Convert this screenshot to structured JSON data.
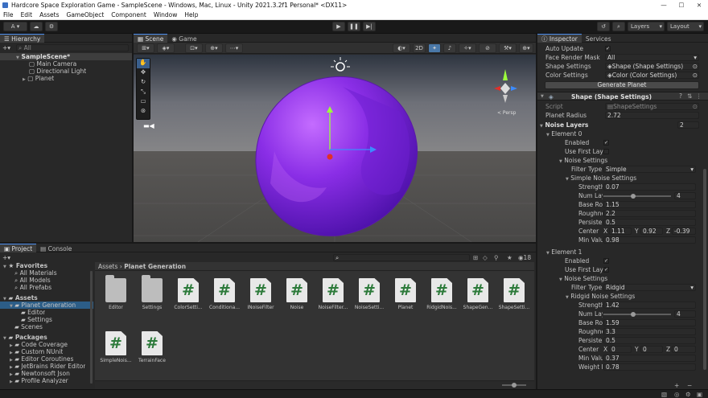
{
  "window": {
    "title": "Hardcore Space Exploration Game - SampleScene - Windows, Mac, Linux - Unity 2021.3.2f1 Personal* <DX11>",
    "minimize": "—",
    "maximize": "☐",
    "close": "✕"
  },
  "menu": [
    "File",
    "Edit",
    "Assets",
    "GameObject",
    "Component",
    "Window",
    "Help"
  ],
  "toolbar": {
    "account": "A",
    "layers": "Layers",
    "layout": "Layout"
  },
  "hierarchy": {
    "tab": "Hierarchy",
    "search_placeholder": "All",
    "scene": "SampleScene*",
    "items": [
      "Main Camera",
      "Directional Light",
      "Planet"
    ]
  },
  "scene": {
    "tabs": [
      "Scene",
      "Game"
    ],
    "mode2d": "2D",
    "persp": "< Persp"
  },
  "project": {
    "tabs": [
      "Project",
      "Console"
    ],
    "breadcrumb": [
      "Assets",
      "Planet Generation"
    ],
    "count": "18",
    "favorites": {
      "label": "Favorites",
      "items": [
        "All Materials",
        "All Models",
        "All Prefabs"
      ]
    },
    "assets_tree": {
      "label": "Assets",
      "items": [
        {
          "label": "Planet Generation",
          "children": [
            "Editor",
            "Settings"
          ]
        },
        {
          "label": "Scenes"
        }
      ]
    },
    "packages": {
      "label": "Packages",
      "items": [
        "Code Coverage",
        "Custom NUnit",
        "Editor Coroutines",
        "JetBrains Rider Editor",
        "Newtonsoft Json",
        "Profile Analyzer"
      ]
    },
    "assets": [
      {
        "name": "Editor",
        "type": "folder"
      },
      {
        "name": "Settings",
        "type": "folder"
      },
      {
        "name": "ColorSetti...",
        "type": "script"
      },
      {
        "name": "Conditiona...",
        "type": "script"
      },
      {
        "name": "INoiseFilter",
        "type": "script"
      },
      {
        "name": "Noise",
        "type": "script"
      },
      {
        "name": "NoiseFilter...",
        "type": "script"
      },
      {
        "name": "NoiseSetti...",
        "type": "script"
      },
      {
        "name": "Planet",
        "type": "script"
      },
      {
        "name": "RidgidNois...",
        "type": "script"
      },
      {
        "name": "ShapeGen...",
        "type": "script"
      },
      {
        "name": "ShapeSetti...",
        "type": "script"
      },
      {
        "name": "SimpleNois...",
        "type": "script"
      },
      {
        "name": "TerrainFace",
        "type": "script"
      }
    ]
  },
  "inspector": {
    "tabs": [
      "Inspector",
      "Services"
    ],
    "auto_update": "Auto Update",
    "face_render_mask": "Face Render Mask",
    "face_render_value": "All",
    "shape_settings": "Shape Settings",
    "shape_settings_value": "Shape (Shape Settings)",
    "color_settings": "Color Settings",
    "color_settings_value": "Color (Color Settings)",
    "generate_button": "Generate Planet",
    "component_title": "Shape (Shape Settings)",
    "script_label": "Script",
    "script_value": "ShapeSettings",
    "planet_radius": "Planet Radius",
    "planet_radius_value": "2.72",
    "noise_layers": "Noise Layers",
    "noise_layers_value": "2",
    "element0": {
      "label": "Element 0",
      "enabled": "Enabled",
      "use_first": "Use First Laye",
      "noise_settings": "Noise Settings",
      "filter_type": "Filter Type",
      "filter_value": "Simple",
      "sub": "Simple Noise Settings",
      "strength": "Strength",
      "strength_value": "0.07",
      "num_layers": "Num Lay",
      "num_layers_value": "4",
      "base_rough": "Base Ro",
      "base_rough_value": "1.15",
      "roughness": "Roughne",
      "roughness_value": "2.2",
      "persistence": "Persister",
      "persistence_value": "0.5",
      "center": "Center",
      "cx": "1.11",
      "cy": "0.92",
      "cz": "-0.39",
      "min_value": "Min Valu",
      "min_value_value": "0.98"
    },
    "element1": {
      "label": "Element 1",
      "enabled": "Enabled",
      "use_first": "Use First Laye",
      "noise_settings": "Noise Settings",
      "filter_type": "Filter Type",
      "filter_value": "Ridgid",
      "sub": "Ridgid Noise Settings",
      "strength": "Strength",
      "strength_value": "1.42",
      "num_layers": "Num Lay",
      "num_layers_value": "4",
      "base_rough": "Base Ro",
      "base_rough_value": "1.59",
      "roughness": "Roughne",
      "roughness_value": "3.3",
      "persistence": "Persister",
      "persistence_value": "0.5",
      "center": "Center",
      "cx": "0",
      "cy": "0",
      "cz": "0",
      "min_value": "Min Valu",
      "min_value_value": "0.37",
      "weight": "Weight M",
      "weight_value": "0.78"
    },
    "axis_x": "X",
    "axis_y": "Y",
    "axis_z": "Z"
  }
}
